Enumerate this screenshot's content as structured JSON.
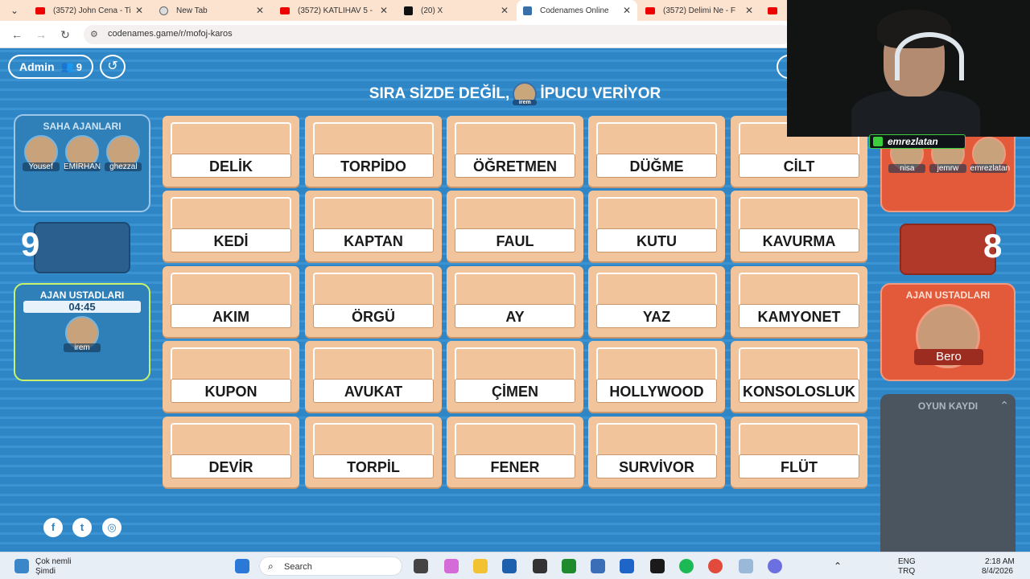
{
  "browser": {
    "tabs": [
      {
        "label": "(3572) John Cena - Ti",
        "icon": "youtube-icon"
      },
      {
        "label": "New Tab",
        "icon": "globe-icon"
      },
      {
        "label": "(3572) KATLİHAV 5 - ",
        "icon": "youtube-icon"
      },
      {
        "label": "(20) X",
        "icon": "x-icon"
      },
      {
        "label": "Codenames Online",
        "icon": "codenames-icon"
      },
      {
        "label": "(3572) Delimi Ne - F",
        "icon": "youtube-icon"
      },
      {
        "label": "(3",
        "icon": "youtube-icon"
      }
    ],
    "url": "codenames.game/r/mofoj-karos"
  },
  "game": {
    "admin_label": "Admin",
    "player_count": "9",
    "turn_prefix": "SIRA SİZDE DEĞİL,",
    "turn_suffix": "İPUCU VERİYOR",
    "turn_avatar_name": "irem",
    "blue": {
      "operatives_title": "SAHA AJANLARI",
      "operatives": [
        "Yousef",
        "EMİRHAN",
        "ghezzal"
      ],
      "score": "9",
      "spymasters_title": "AJAN USTADLARI",
      "timer": "04:45",
      "spymaster": "irem"
    },
    "red": {
      "operatives": [
        "nisa",
        "jemrw",
        "emrezlatan"
      ],
      "score": "8",
      "spymasters_title": "AJAN USTADLARI",
      "spymaster": "Bero"
    },
    "cards": [
      [
        "DELİK",
        "TORPİDO",
        "ÖĞRETMEN",
        "DÜĞME",
        "CİLT"
      ],
      [
        "KEDİ",
        "KAPTAN",
        "FAUL",
        "KUTU",
        "KAVURMA"
      ],
      [
        "AKIM",
        "ÖRGÜ",
        "AY",
        "YAZ",
        "KAMYONET"
      ],
      [
        "KUPON",
        "AVUKAT",
        "ÇİMEN",
        "HOLLYWOOD",
        "KONSOLOSLUK"
      ],
      [
        "DEVİR",
        "TORPİL",
        "FENER",
        "SURVİVOR",
        "FLÜT"
      ]
    ],
    "log_title": "OYUN KAYDI",
    "social": [
      "facebook-icon",
      "twitter-icon",
      "instagram-icon"
    ]
  },
  "stream": {
    "tag": "emrezlatan"
  },
  "taskbar": {
    "notif_title": "Çok nemli",
    "notif_sub": "Şimdi",
    "search_placeholder": "Search",
    "lang1": "ENG",
    "lang2": "TRQ",
    "time": "2:18 AM",
    "date": "8/4/2026"
  },
  "colors": {
    "blue_team": "#2f7fb8",
    "red_team": "#e35a3a",
    "card": "#f2c49c"
  }
}
